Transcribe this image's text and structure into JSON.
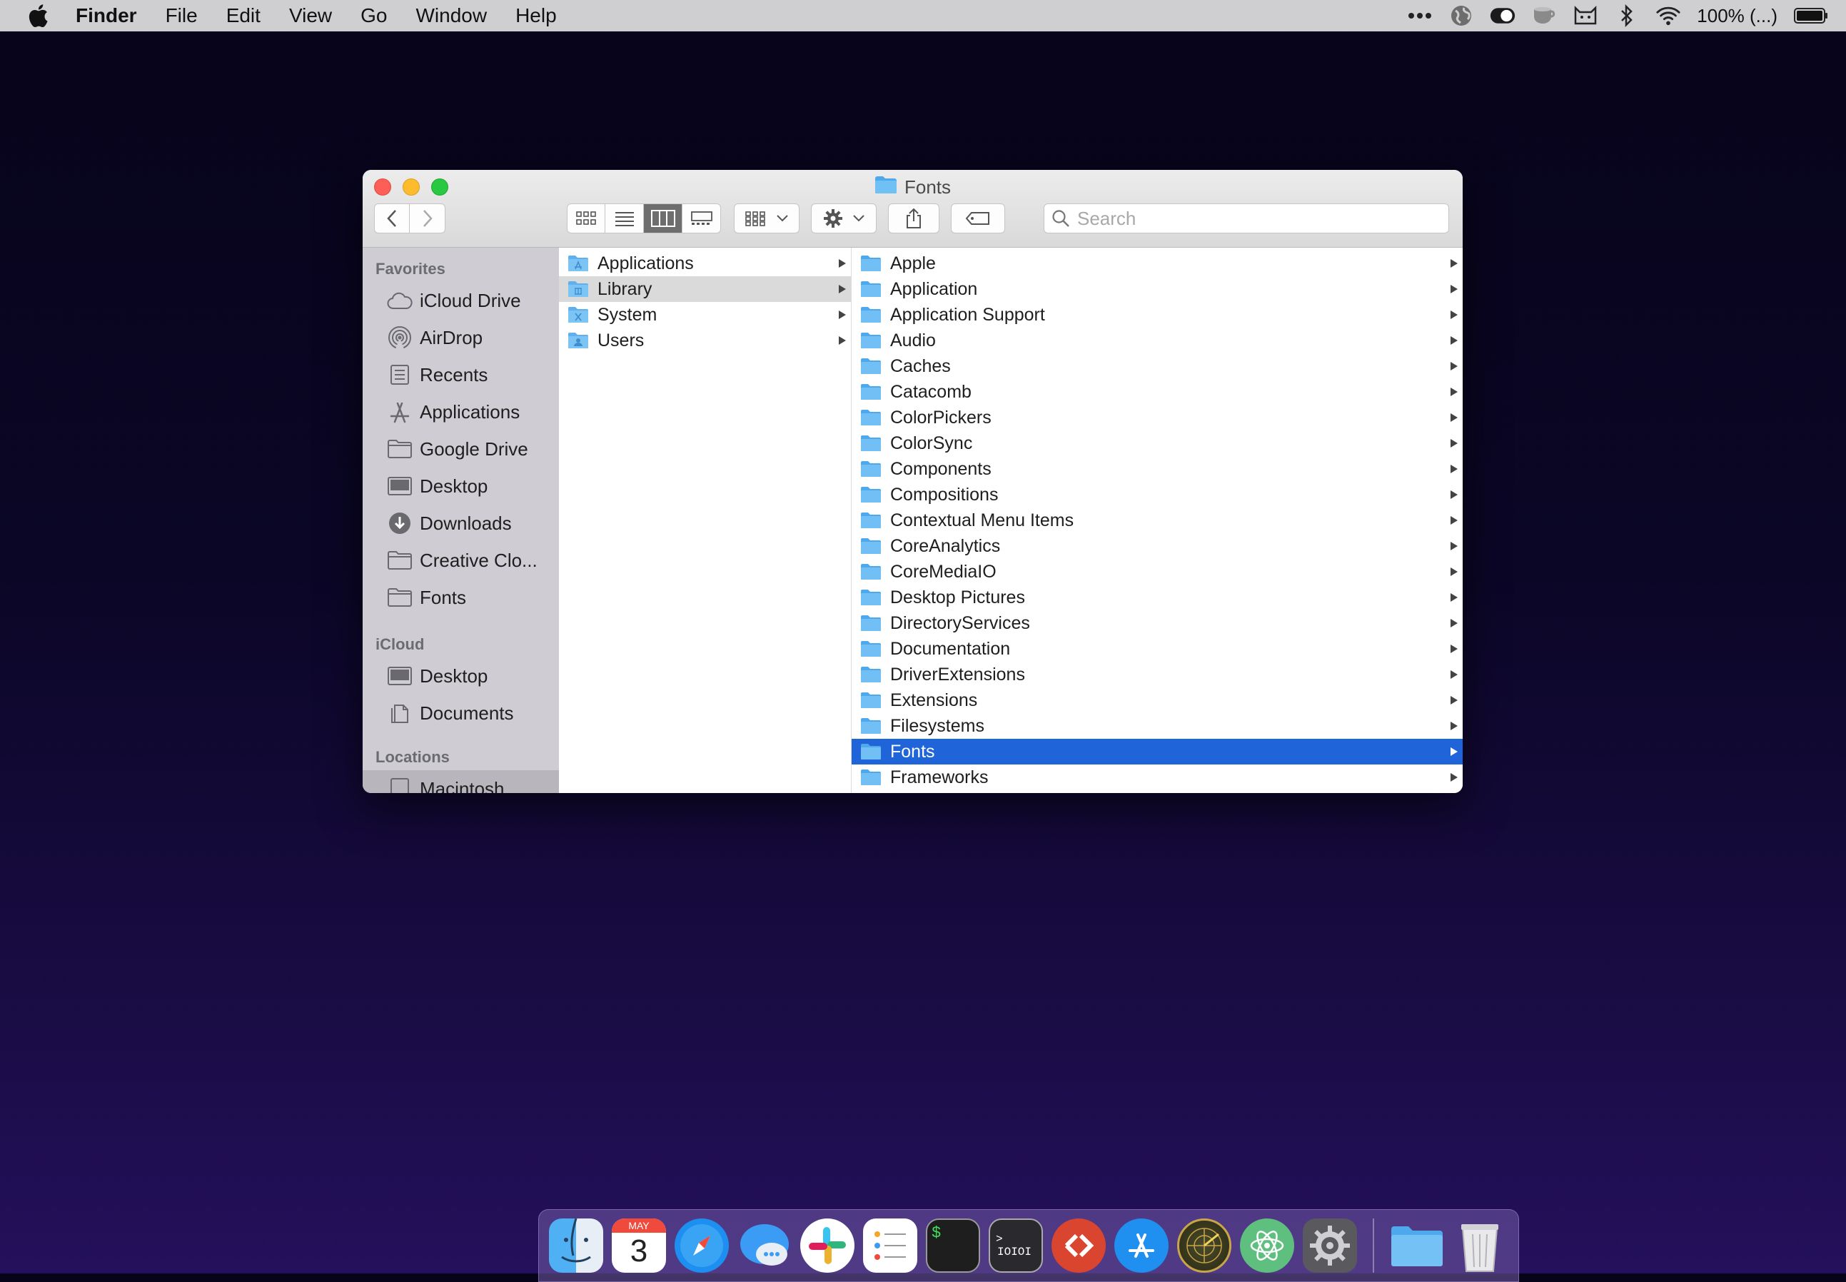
{
  "menubar": {
    "app_name": "Finder",
    "items": [
      "File",
      "Edit",
      "View",
      "Go",
      "Window",
      "Help"
    ],
    "battery": "100% (...)"
  },
  "window": {
    "title": "Fonts",
    "search_placeholder": "Search"
  },
  "sidebar": {
    "favorites_header": "Favorites",
    "favorites": [
      {
        "label": "iCloud Drive",
        "icon": "cloud-icon"
      },
      {
        "label": "AirDrop",
        "icon": "airdrop-icon"
      },
      {
        "label": "Recents",
        "icon": "recents-icon"
      },
      {
        "label": "Applications",
        "icon": "applications-icon"
      },
      {
        "label": "Google Drive",
        "icon": "folder-icon"
      },
      {
        "label": "Desktop",
        "icon": "desktop-icon"
      },
      {
        "label": "Downloads",
        "icon": "downloads-icon"
      },
      {
        "label": "Creative Clo...",
        "icon": "folder-icon"
      },
      {
        "label": "Fonts",
        "icon": "folder-icon"
      }
    ],
    "icloud_header": "iCloud",
    "icloud": [
      {
        "label": "Desktop",
        "icon": "desktop-icon"
      },
      {
        "label": "Documents",
        "icon": "documents-icon"
      }
    ],
    "locations_header": "Locations",
    "locations": [
      {
        "label": "Macintosh",
        "icon": "disk-icon"
      }
    ]
  },
  "column1": [
    "Applications",
    "Library",
    "System",
    "Users"
  ],
  "column2": [
    "Apple",
    "Application",
    "Application Support",
    "Audio",
    "Caches",
    "Catacomb",
    "ColorPickers",
    "ColorSync",
    "Components",
    "Compositions",
    "Contextual Menu Items",
    "CoreAnalytics",
    "CoreMediaIO",
    "Desktop Pictures",
    "DirectoryServices",
    "Documentation",
    "DriverExtensions",
    "Extensions",
    "Filesystems",
    "Fonts",
    "Frameworks"
  ],
  "dock": {
    "calendar_month": "MAY",
    "calendar_day": "3",
    "terminal_prompt": "$",
    "console_text": "IOIOI",
    "console_prompt": ">",
    "apps": [
      "finder-icon",
      "calendar-icon",
      "safari-icon",
      "messages-icon",
      "slack-icon",
      "reminders-icon",
      "terminal-icon",
      "console-icon",
      "remote-desktop-icon",
      "app-store-icon",
      "radar-icon",
      "atom-icon",
      "system-preferences-icon",
      "folder-icon",
      "trash-icon"
    ]
  },
  "colors": {
    "selection_blue": "#1f64d8",
    "folder_blue": "#63b3ef"
  }
}
